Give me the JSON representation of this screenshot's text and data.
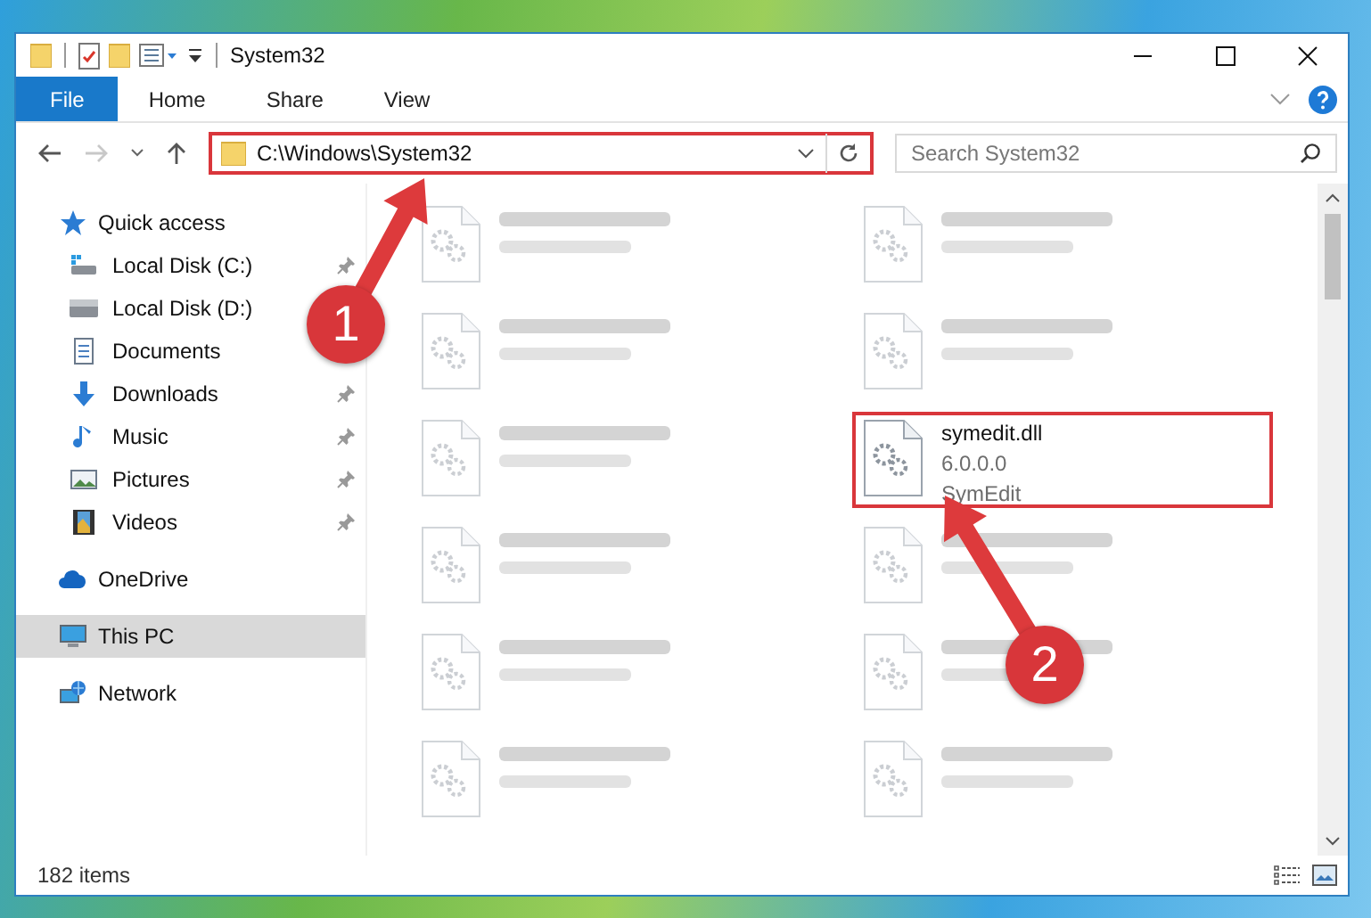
{
  "window": {
    "title": "System32"
  },
  "ribbon": {
    "tabs": [
      {
        "label": "File",
        "selected": true
      },
      {
        "label": "Home",
        "selected": false
      },
      {
        "label": "Share",
        "selected": false
      },
      {
        "label": "View",
        "selected": false
      }
    ]
  },
  "address": {
    "path": "C:\\Windows\\System32",
    "highlighted": true
  },
  "search": {
    "placeholder": "Search System32"
  },
  "sidebar": {
    "items": [
      {
        "label": "Quick access",
        "selected": false,
        "children": [
          {
            "label": "Local Disk (C:)",
            "pinned": true,
            "selected": false
          },
          {
            "label": "Local Disk (D:)",
            "selected": false
          },
          {
            "label": "Documents",
            "selected": false
          },
          {
            "label": "Downloads",
            "pinned": true,
            "selected": false
          },
          {
            "label": "Music",
            "pinned": true,
            "selected": false
          },
          {
            "label": "Pictures",
            "pinned": true,
            "selected": false
          },
          {
            "label": "Videos",
            "pinned": true,
            "selected": false
          }
        ]
      },
      {
        "label": "OneDrive",
        "selected": false
      },
      {
        "label": "This PC",
        "selected": true
      },
      {
        "label": "Network",
        "selected": false
      }
    ]
  },
  "files": [
    {
      "kind": "blurred"
    },
    {
      "kind": "blurred"
    },
    {
      "kind": "blurred"
    },
    {
      "kind": "blurred"
    },
    {
      "kind": "blurred"
    },
    {
      "name": "symedit.dll",
      "lines": [
        "6.0.0.0",
        "SymEdit"
      ],
      "kind": "sharp",
      "highlighted": true
    },
    {
      "kind": "blurred"
    },
    {
      "kind": "blurred"
    },
    {
      "kind": "blurred"
    },
    {
      "kind": "blurred"
    },
    {
      "kind": "blurred"
    },
    {
      "kind": "blurred"
    }
  ],
  "status_bar": {
    "count": "182 items"
  },
  "annotations": [
    {
      "label": "1"
    },
    {
      "label": "2"
    }
  ]
}
